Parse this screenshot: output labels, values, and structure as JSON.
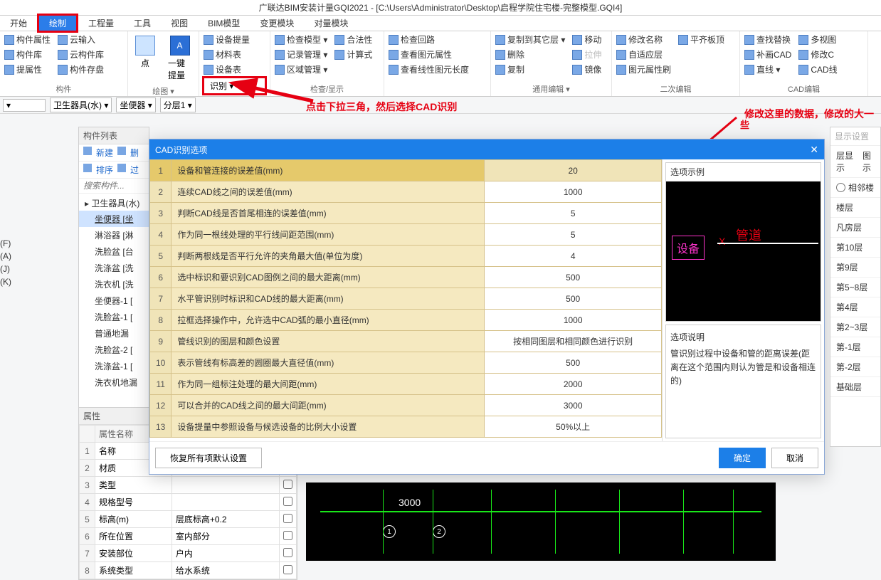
{
  "title": "广联达BIM安装计量GQI2021 - [C:\\Users\\Administrator\\Desktop\\启程学院住宅楼-完整模型.GQI4]",
  "menu": [
    "开始",
    "绘制",
    "工程量",
    "工具",
    "视图",
    "BIM模型",
    "变更模块",
    "对量模块"
  ],
  "ribbon": {
    "group1": {
      "items": [
        "构件属性",
        "构件库",
        "提属性"
      ],
      "right_items": [
        "云输入",
        "云构件库",
        "构件存盘"
      ],
      "title": "构件"
    },
    "group2": {
      "items": [
        "点",
        "一键提量"
      ],
      "title": "绘图 ▾"
    },
    "group3": {
      "big": "识别 ▾",
      "title": "识别 ▾"
    },
    "group4": {
      "items": [
        "设备提量",
        "记录管理 ▾",
        "区域管理 ▾"
      ],
      "right": [
        "材料表",
        "设备表"
      ],
      "title": ""
    },
    "group5": {
      "items": [
        "检查模型 ▾",
        "合法性",
        "计算式"
      ],
      "right_items": [
        "检查回路",
        "查看图元属性",
        "查看线性图元长度"
      ],
      "title": "检查/显示"
    },
    "group6": {
      "items": [
        "复制到其它层 ▾",
        "删除",
        "复制"
      ],
      "right_items": [
        "移动",
        "拉伸",
        "镜像"
      ],
      "title": "通用编辑 ▾"
    },
    "group7": {
      "items": [
        "修改名称",
        "自适应层",
        "图元属性刷"
      ],
      "right_items": [
        "平齐板顶"
      ],
      "title": "二次编辑"
    },
    "group8": {
      "items": [
        "查找替换",
        "补画CAD",
        "直线 ▾"
      ],
      "right_items": [
        "多视图",
        "修改C",
        "CAD线"
      ],
      "title": "CAD编辑"
    }
  },
  "context": {
    "dd1": "卫生器具(水)",
    "dd2": "坐便器",
    "dd3": "分层1"
  },
  "annotation1": "点击下拉三角，然后选择CAD识别",
  "annotation2": "修改这里的数据，修改的大一",
  "annotation_xie": "些",
  "left_letters": [
    "(F)",
    "(A)",
    "(J)",
    "(K)"
  ],
  "componentPanel": {
    "title": "构件列表",
    "btns": [
      "新建",
      "删"
    ],
    "btns2": [
      "排序",
      "过"
    ],
    "search_placeholder": "搜索构件...",
    "root": "卫生器具(水)",
    "items": [
      "坐便器 [坐",
      "淋浴器 [淋",
      "洗脸盆 [台",
      "洗涤盆 [洗",
      "洗衣机 [洗",
      "坐便器-1 [",
      "洗脸盆-1 [",
      "普通地漏",
      "洗脸盆-2 [",
      "洗涤盆-1 [",
      "洗衣机地漏"
    ]
  },
  "properties": {
    "title": "属性",
    "header_name": "属性名称",
    "rows": [
      {
        "n": "1",
        "k": "名称",
        "v": "",
        "c": false
      },
      {
        "n": "2",
        "k": "材质",
        "v": "",
        "c": false
      },
      {
        "n": "3",
        "k": "类型",
        "v": "",
        "c": true
      },
      {
        "n": "4",
        "k": "规格型号",
        "v": "",
        "c": true
      },
      {
        "n": "5",
        "k": "标高(m)",
        "v": "层底标高+0.2",
        "c": true
      },
      {
        "n": "6",
        "k": "所在位置",
        "v": "室内部分",
        "c": true
      },
      {
        "n": "7",
        "k": "安装部位",
        "v": "户内",
        "c": true
      },
      {
        "n": "8",
        "k": "系统类型",
        "v": "给水系统",
        "c": true
      }
    ]
  },
  "dialog": {
    "title": "CAD识别选项",
    "rows": [
      {
        "n": "1",
        "k": "设备和管连接的误差值(mm)",
        "v": "20",
        "sel": true
      },
      {
        "n": "2",
        "k": "连续CAD线之间的误差值(mm)",
        "v": "1000"
      },
      {
        "n": "3",
        "k": "判断CAD线是否首尾相连的误差值(mm)",
        "v": "5"
      },
      {
        "n": "4",
        "k": "作为同一根线处理的平行线间距范围(mm)",
        "v": "5"
      },
      {
        "n": "5",
        "k": "判断两根线是否平行允许的夹角最大值(单位为度)",
        "v": "4"
      },
      {
        "n": "6",
        "k": "选中标识和要识别CAD图例之间的最大距离(mm)",
        "v": "500"
      },
      {
        "n": "7",
        "k": "水平管识别时标识和CAD线的最大距离(mm)",
        "v": "500"
      },
      {
        "n": "8",
        "k": "拉框选择操作中，允许选中CAD弧的最小直径(mm)",
        "v": "1000"
      },
      {
        "n": "9",
        "k": "管线识别的图层和颜色设置",
        "v": "按相同图层和相同颜色进行识别"
      },
      {
        "n": "10",
        "k": "表示管线有标高差的圆圈最大直径值(mm)",
        "v": "500"
      },
      {
        "n": "11",
        "k": "作为同一组标注处理的最大间距(mm)",
        "v": "2000"
      },
      {
        "n": "12",
        "k": "可以合并的CAD线之间的最大间距(mm)",
        "v": "3000"
      },
      {
        "n": "13",
        "k": "设备提量中参照设备与候选设备的比例大小设置",
        "v": "50%以上"
      }
    ],
    "example_head": "选项示例",
    "example_device": "设备",
    "example_pipe": "管道",
    "desc_head": "选项说明",
    "desc_body": "管识别过程中设备和管的距离误差(距离在这个范围内则认为管是和设备相连的)",
    "restore": "恢复所有项默认设置",
    "ok": "确定",
    "cancel": "取消"
  },
  "cad": {
    "dist": "3000",
    "circles": [
      "1",
      "2"
    ]
  },
  "rightPanel": {
    "head": "显示设置",
    "tabs_row1": [
      "层显示",
      "图示"
    ],
    "radio": "相邻楼",
    "floors": [
      "楼层",
      "凡房层",
      "第10层",
      "第9层",
      "第5~8层",
      "第4层",
      "第2~3层",
      "第-1层",
      "第-2层",
      "基础层"
    ]
  }
}
